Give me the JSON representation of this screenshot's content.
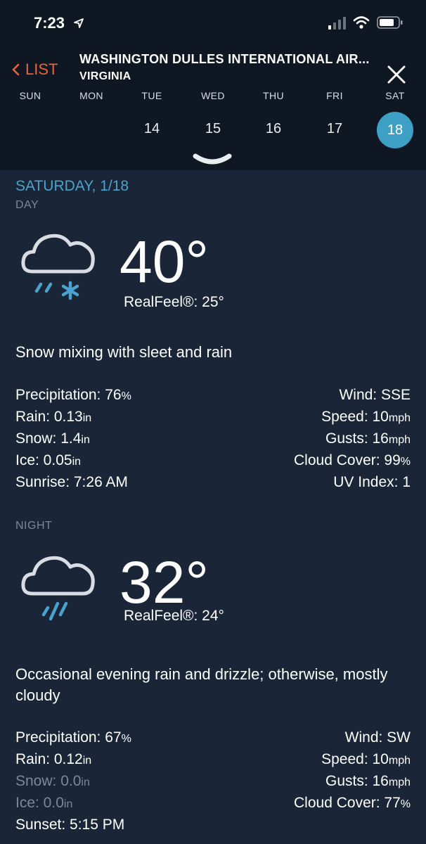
{
  "status_bar": {
    "time": "7:23"
  },
  "header": {
    "back_label": "LIST",
    "location_name": "WASHINGTON DULLES INTERNATIONAL AIR...",
    "location_region": "VIRGINIA"
  },
  "week": {
    "days": [
      "SUN",
      "MON",
      "TUE",
      "WED",
      "THU",
      "FRI",
      "SAT"
    ],
    "dates": [
      "",
      "",
      "14",
      "15",
      "16",
      "17",
      "18"
    ],
    "selected_date": "18"
  },
  "forecast_title": "SATURDAY, 1/18",
  "day": {
    "label": "DAY",
    "icon": "cloud-sleet-snow-icon",
    "temp": "40°",
    "realfeel": "RealFeel®: 25°",
    "description": "Snow mixing with sleet and rain",
    "left": [
      {
        "label": "Precipitation: 76",
        "unit": "%"
      },
      {
        "label": "Rain: 0.13",
        "unit": "in"
      },
      {
        "label": "Snow: 1.4",
        "unit": "in"
      },
      {
        "label": "Ice: 0.05",
        "unit": "in"
      },
      {
        "label": "Sunrise: 7:26 AM",
        "unit": ""
      }
    ],
    "right": [
      {
        "label": "Wind: SSE",
        "unit": ""
      },
      {
        "label": "Speed: 10",
        "unit": "mph"
      },
      {
        "label": "Gusts: 16",
        "unit": "mph"
      },
      {
        "label": "Cloud Cover: 99",
        "unit": "%"
      },
      {
        "label": "UV Index: 1",
        "unit": ""
      }
    ]
  },
  "night": {
    "label": "NIGHT",
    "icon": "cloud-rain-icon",
    "temp": "32°",
    "realfeel": "RealFeel®: 24°",
    "description": "Occasional evening rain and drizzle; otherwise, mostly cloudy",
    "left": [
      {
        "label": "Precipitation: 67",
        "unit": "%"
      },
      {
        "label": "Rain: 0.12",
        "unit": "in"
      },
      {
        "label": "Snow: 0.0",
        "unit": "in"
      },
      {
        "label": "Ice: 0.0",
        "unit": "in"
      },
      {
        "label": "Sunset: 5:15 PM",
        "unit": ""
      }
    ],
    "right": [
      {
        "label": "Wind: SW",
        "unit": ""
      },
      {
        "label": "Speed: 10",
        "unit": "mph"
      },
      {
        "label": "Gusts: 16",
        "unit": "mph"
      },
      {
        "label": "Cloud Cover: 77",
        "unit": "%"
      }
    ]
  },
  "colors": {
    "accent": "#e8643a",
    "title_blue": "#4aa3cf",
    "selected_circle": "#3fa0c6",
    "background": "#1a2637",
    "header_bg": "#0f1722"
  }
}
